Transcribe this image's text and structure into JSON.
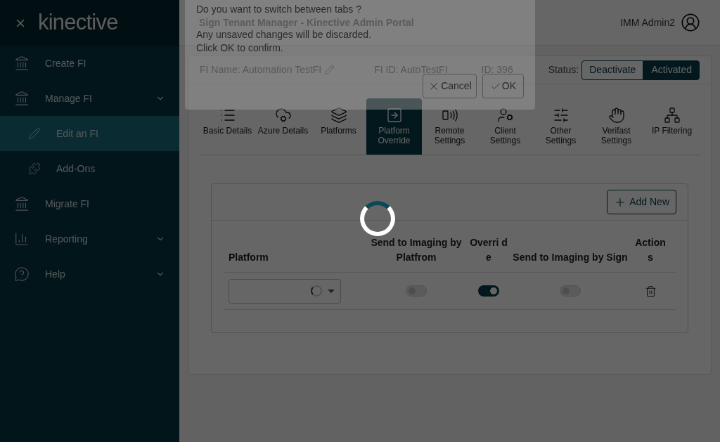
{
  "sidebar": {
    "logo": "kinective",
    "items": [
      {
        "label": "Create FI",
        "expandable": false,
        "selected": false
      },
      {
        "label": "Manage FI",
        "expandable": true,
        "selected": false,
        "children": [
          {
            "label": "Edit an FI",
            "selected": true
          },
          {
            "label": "Add-Ons",
            "selected": false
          }
        ]
      },
      {
        "label": "Migrate FI",
        "expandable": false,
        "selected": false
      },
      {
        "label": "Reporting",
        "expandable": true,
        "selected": false
      },
      {
        "label": "Help",
        "expandable": true,
        "selected": false
      }
    ]
  },
  "header": {
    "title": "Sign Tenant Manager - Kinective Admin Portal",
    "user": "IMM Admin2"
  },
  "fi": {
    "name": "FI Name: Automation TestFI",
    "fi_id": "FI ID: AutoTestFI",
    "id": "ID: 396",
    "status_label": "Status:",
    "status_options": [
      {
        "label": "Deactivate",
        "selected": false
      },
      {
        "label": "Activated",
        "selected": true
      }
    ]
  },
  "tabs": [
    {
      "label": "Basic Details",
      "selected": false
    },
    {
      "label": "Azure Details",
      "selected": false
    },
    {
      "label": "Platforms",
      "selected": false
    },
    {
      "label": "Platform Override",
      "selected": true
    },
    {
      "label": "Remote Settings",
      "selected": false
    },
    {
      "label": "Client Settings",
      "selected": false
    },
    {
      "label": "Other Settings",
      "selected": false
    },
    {
      "label": "Verifast Settings",
      "selected": false
    },
    {
      "label": "IP Filtering",
      "selected": false
    }
  ],
  "table": {
    "add_button": "Add New",
    "columns": [
      "Platform",
      "Send to Imaging by Platfrom",
      "Overri de",
      "Send to Imaging by Sign",
      "Action s"
    ],
    "rows": [
      {
        "platform_loading": true,
        "send_by_platform": false,
        "override": true,
        "send_by_sign": false
      }
    ]
  },
  "dialog": {
    "lines": [
      "Do you want to switch between tabs ?",
      "Any unsaved changes will be discarded.",
      "Click OK to confirm."
    ],
    "cancel": "Cancel",
    "ok": "OK"
  }
}
